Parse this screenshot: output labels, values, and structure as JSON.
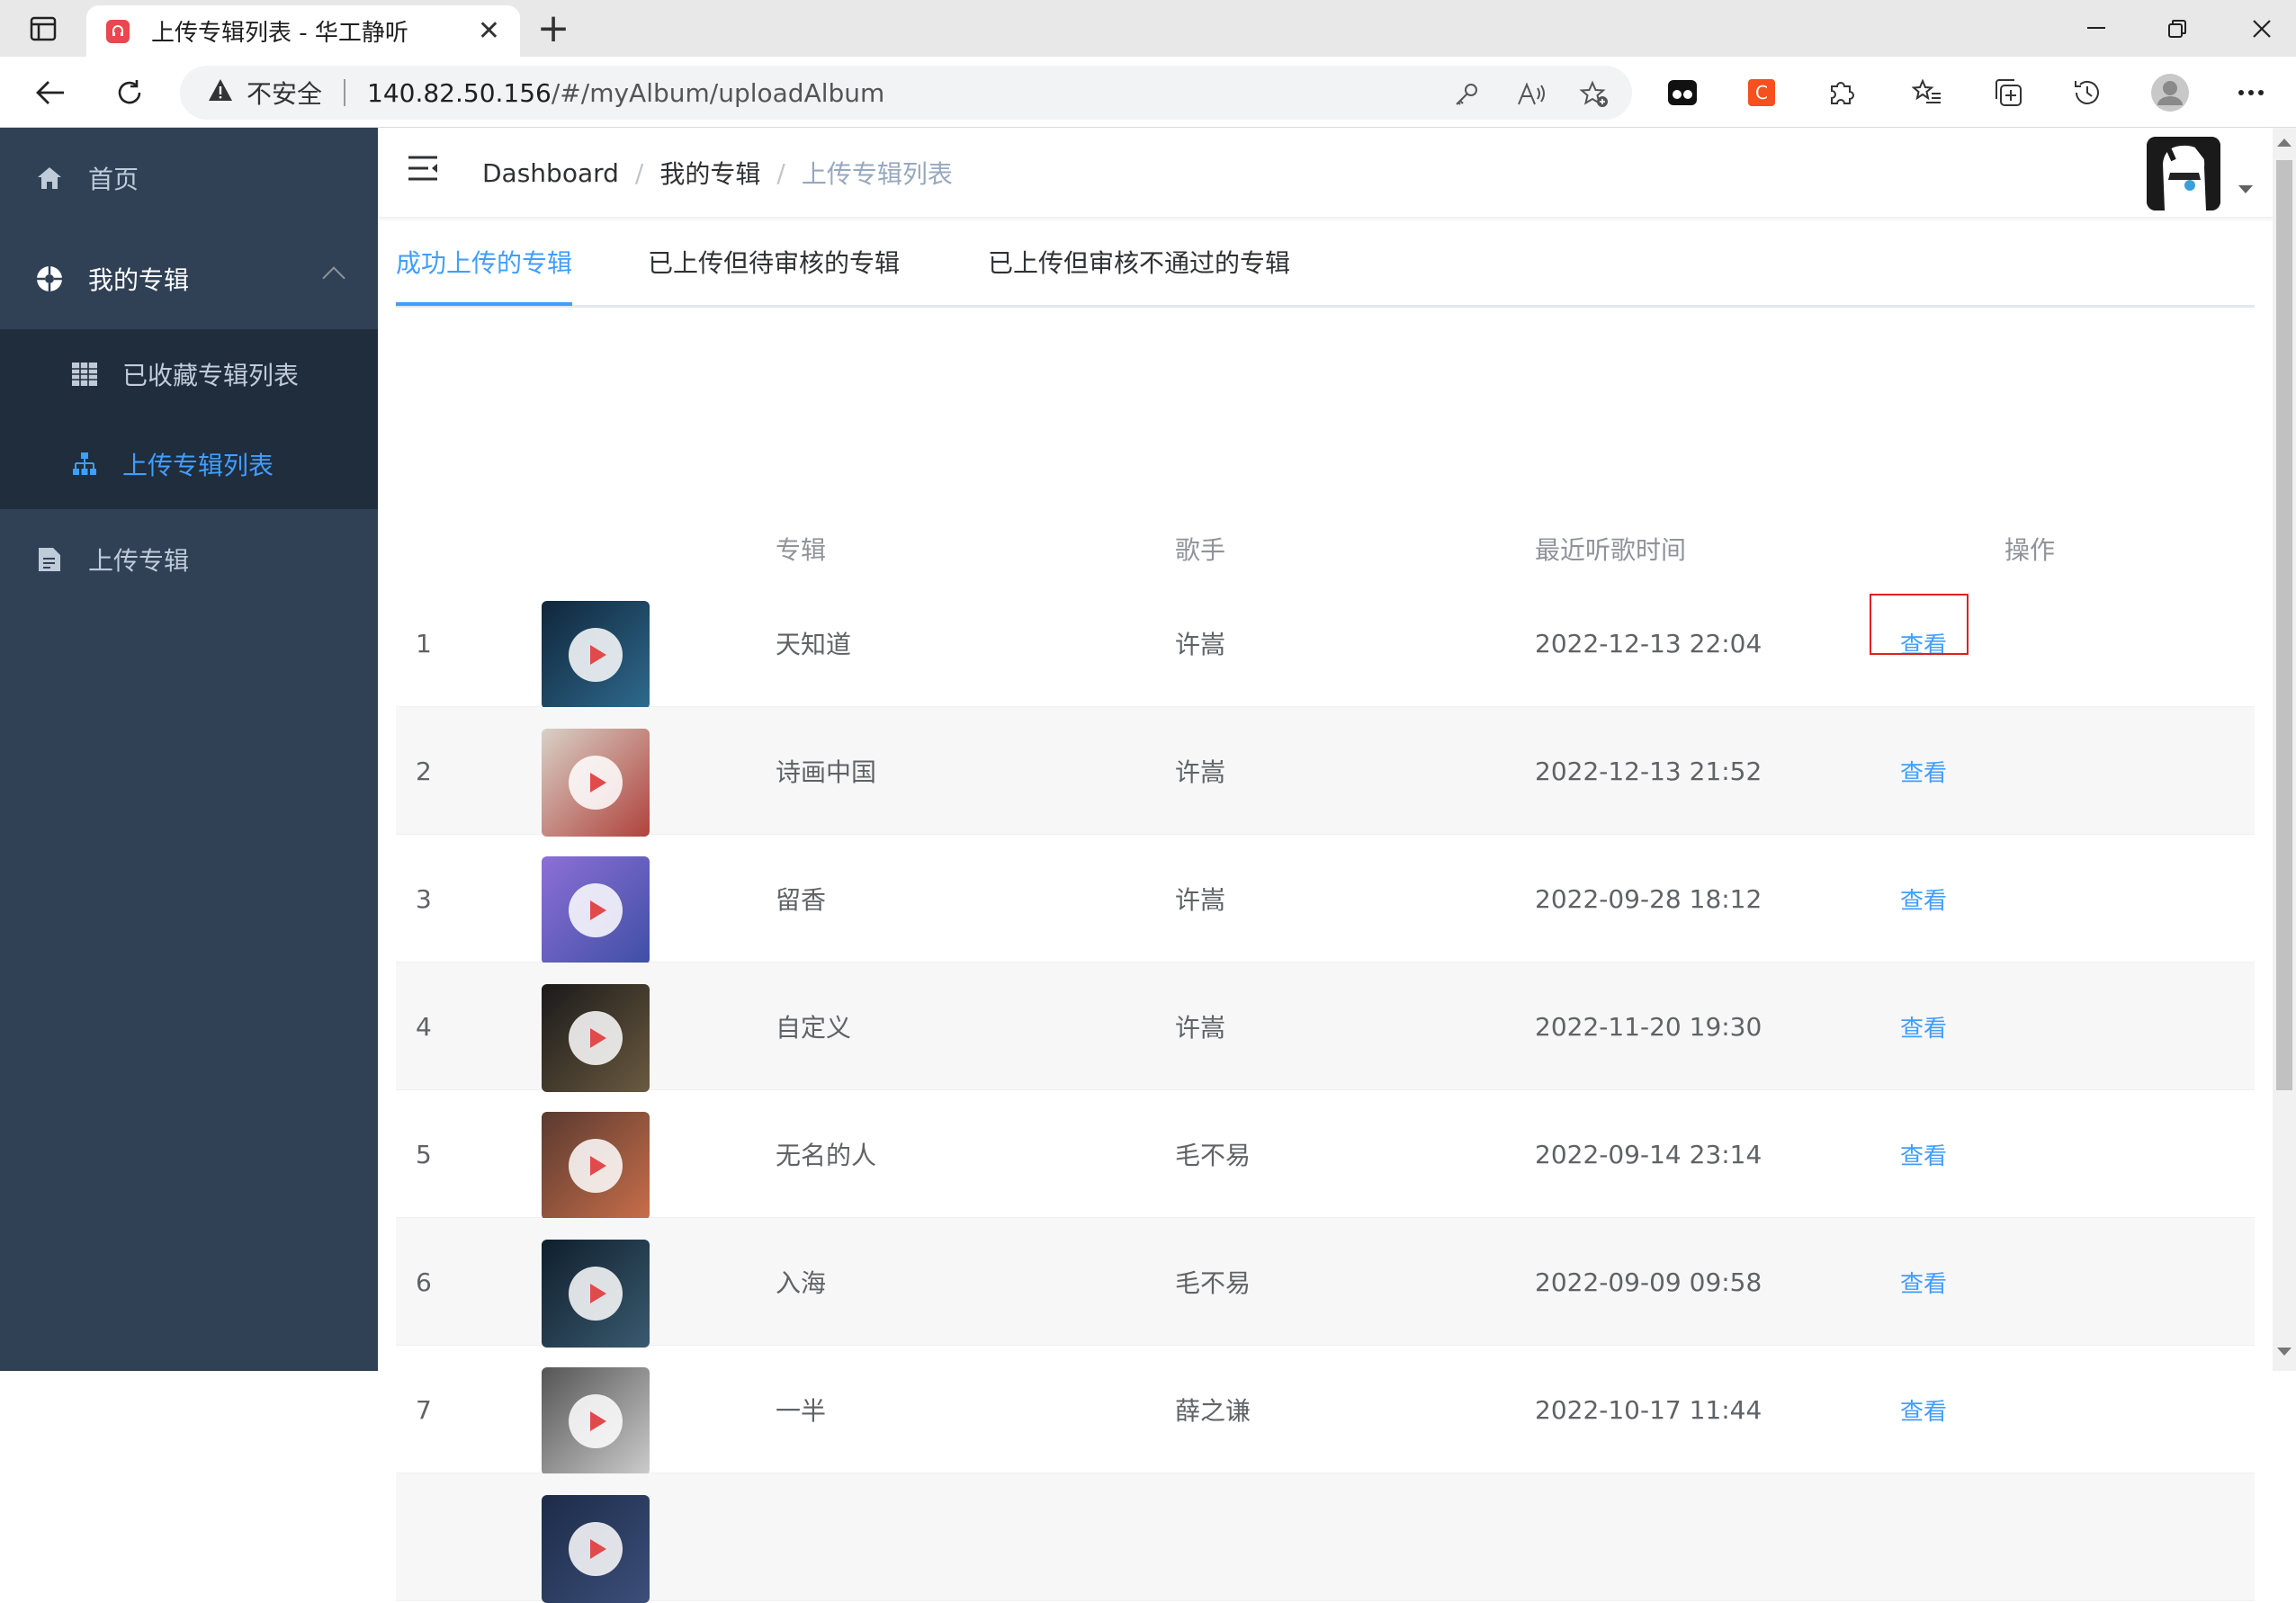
{
  "browser": {
    "tab_title": "上传专辑列表 - 华工静听",
    "address": {
      "security_label": "不安全",
      "host": "140.82.50.156",
      "path": "/#/myAlbum/uploadAlbum"
    }
  },
  "sidebar": {
    "items": [
      {
        "label": "首页",
        "icon": "home-icon"
      },
      {
        "label": "我的专辑",
        "icon": "album-icon",
        "expanded": true
      },
      {
        "label": "上传专辑",
        "icon": "document-icon"
      }
    ],
    "sub_items": [
      {
        "label": "已收藏专辑列表",
        "icon": "grid-icon"
      },
      {
        "label": "上传专辑列表",
        "icon": "tree-icon",
        "active": true
      }
    ]
  },
  "breadcrumb": [
    "Dashboard",
    "我的专辑",
    "上传专辑列表"
  ],
  "tabs": [
    {
      "label": "成功上传的专辑",
      "active": true
    },
    {
      "label": "已上传但待审核的专辑"
    },
    {
      "label": "已上传但审核不通过的专辑"
    }
  ],
  "table": {
    "headers": {
      "album": "专辑",
      "singer": "歌手",
      "time": "最近听歌时间",
      "action": "操作"
    },
    "action_label": "查看",
    "rows": [
      {
        "index": "1",
        "album": "天知道",
        "singer": "许嵩",
        "time": "2022-12-13 22:04",
        "colors": [
          "#10263a",
          "#2f6a8e"
        ]
      },
      {
        "index": "2",
        "album": "诗画中国",
        "singer": "许嵩",
        "time": "2022-12-13 21:52",
        "colors": [
          "#d8d1c7",
          "#b0423c"
        ]
      },
      {
        "index": "3",
        "album": "留香",
        "singer": "许嵩",
        "time": "2022-09-28 18:12",
        "colors": [
          "#8d6fd6",
          "#3f4fa5"
        ]
      },
      {
        "index": "4",
        "album": "自定义",
        "singer": "许嵩",
        "time": "2022-11-20 19:30",
        "colors": [
          "#1a1a1a",
          "#6b5a40"
        ]
      },
      {
        "index": "5",
        "album": "无名的人",
        "singer": "毛不易",
        "time": "2022-09-14 23:14",
        "colors": [
          "#5a3a30",
          "#c86e4a"
        ]
      },
      {
        "index": "6",
        "album": "入海",
        "singer": "毛不易",
        "time": "2022-09-09 09:58",
        "colors": [
          "#0f1f2c",
          "#3a5a70"
        ]
      },
      {
        "index": "7",
        "album": "一半",
        "singer": "薛之谦",
        "time": "2022-10-17 11:44",
        "colors": [
          "#555555",
          "#cccccc"
        ]
      },
      {
        "index": "",
        "album": "",
        "singer": "",
        "time": "",
        "colors": [
          "#1d2b48",
          "#3c4f7a"
        ]
      }
    ]
  }
}
